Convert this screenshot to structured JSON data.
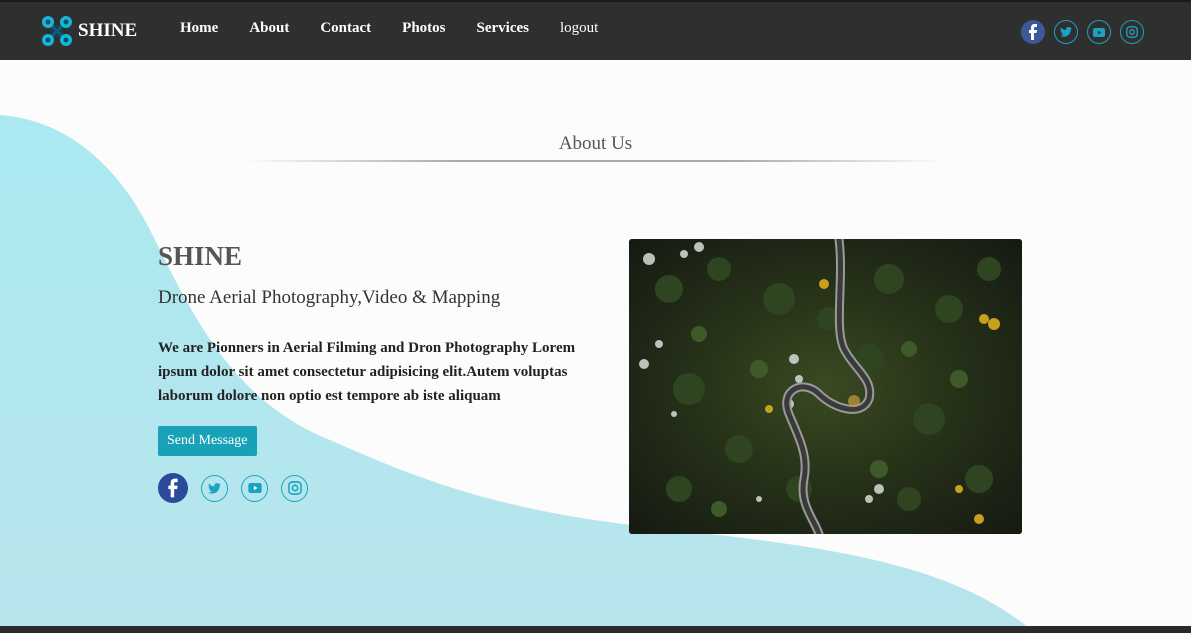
{
  "brand": {
    "name": "SHINE",
    "logo_icon": "drone-icon"
  },
  "nav": {
    "items": [
      {
        "label": "Home"
      },
      {
        "label": "About"
      },
      {
        "label": "Contact"
      },
      {
        "label": "Photos"
      },
      {
        "label": "Services"
      },
      {
        "label": "logout"
      }
    ],
    "social": [
      "facebook-icon",
      "twitter-icon",
      "youtube-icon",
      "instagram-icon"
    ]
  },
  "section": {
    "title": "About Us"
  },
  "about": {
    "company": "SHINE",
    "tagline": "Drone Aerial Photography,Video & Mapping",
    "description": "We are Pionners in Aerial Filming and Dron Photography Lorem ipsum dolor sit amet consectetur adipisicing elit.Autem voluptas laborum dolore non optio est tempore ab iste aliquam",
    "button_label": "Send Message",
    "social": [
      "facebook-icon",
      "twitter-icon",
      "youtube-icon",
      "instagram-icon"
    ]
  },
  "colors": {
    "navbar": "#2f2f2f",
    "accent": "#17a2b8",
    "wave": "#a8e6ee",
    "facebook": "#3b5998"
  },
  "image": {
    "subject": "aerial-forest-road-photo"
  }
}
